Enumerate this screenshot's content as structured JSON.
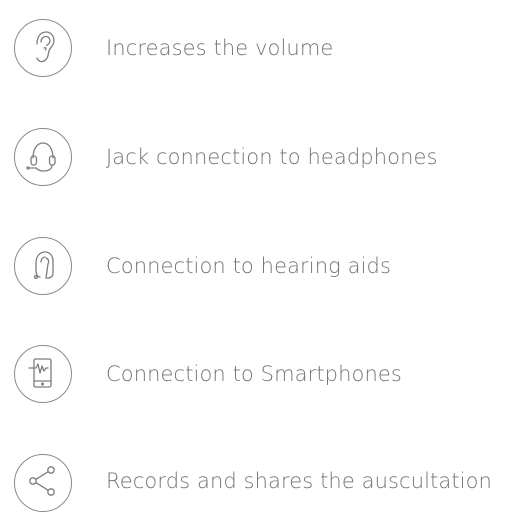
{
  "features": [
    {
      "icon": "ear-icon",
      "label": "Increases the volume"
    },
    {
      "icon": "headphones-icon",
      "label": "Jack connection to headphones"
    },
    {
      "icon": "hearing-aid-icon",
      "label": "Connection to hearing aids"
    },
    {
      "icon": "smartphone-icon",
      "label": "Connection to Smartphones"
    },
    {
      "icon": "share-icon",
      "label": "Records and shares the auscultation"
    }
  ],
  "colors": {
    "text": "#737373",
    "icon_stroke": "#8a8a8a"
  }
}
